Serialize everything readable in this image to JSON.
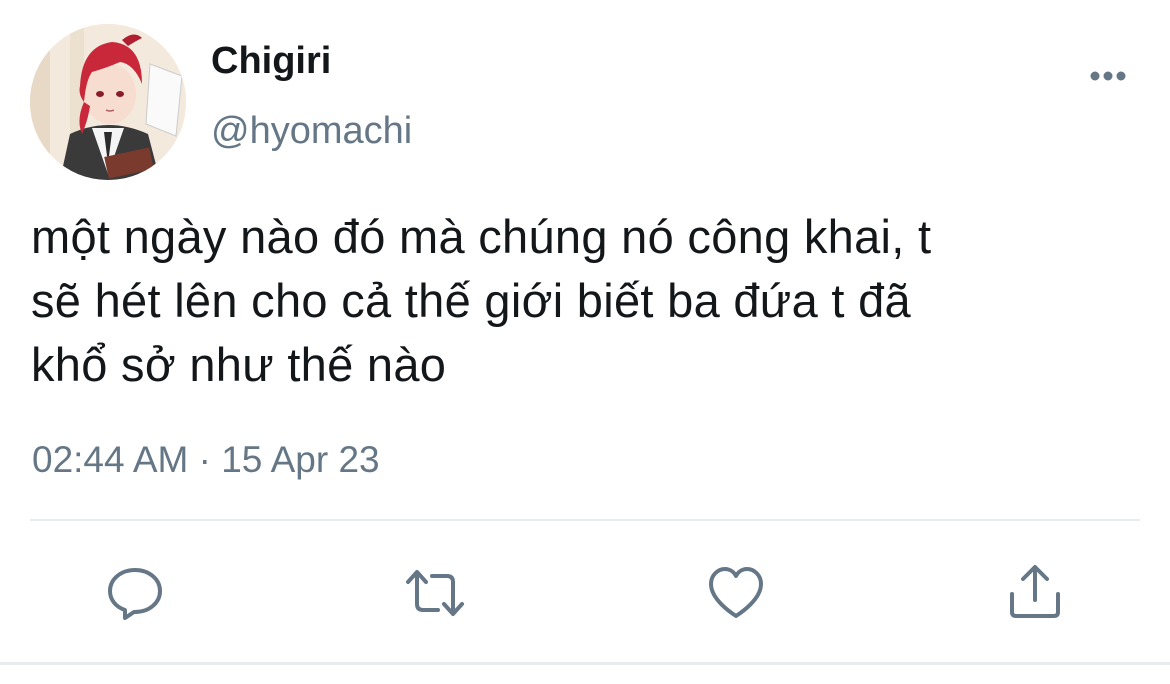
{
  "user": {
    "display_name": "Chigiri",
    "handle": "@hyomachi"
  },
  "tweet": {
    "lines": [
      "một ngày nào đó mà chúng nó công khai, t",
      "sẽ hét lên cho cả thế giới biết ba đứa t đã",
      "khổ sở như thế nào"
    ],
    "timestamp": "02:44 AM · 15 Apr 23"
  },
  "icons": {
    "more": "more-horizontal-icon",
    "reply": "comment-icon",
    "retweet": "retweet-icon",
    "like": "heart-icon",
    "share": "share-icon"
  },
  "colors": {
    "text_primary": "#14171a",
    "text_secondary": "#657786",
    "icon": "#657786",
    "divider": "#e6ecf0"
  }
}
